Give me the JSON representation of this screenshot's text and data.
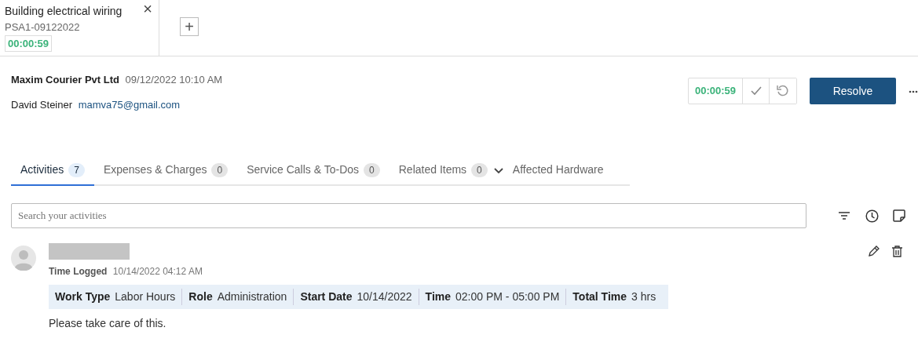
{
  "ticket_tab": {
    "title": "Building electrical wiring",
    "number": "PSA1-09122022",
    "timer": "00:00:59",
    "close": "×"
  },
  "add_tab": {
    "label": "+"
  },
  "header": {
    "company": "Maxim Courier Pvt Ltd",
    "date": "09/12/2022 10:10 AM",
    "contact": "David Steiner",
    "email": "mamva75@gmail.com"
  },
  "timer": {
    "value": "00:00:59"
  },
  "resolve_button": "Resolve",
  "tabs": [
    {
      "label": "Activities",
      "count": "7",
      "selected": true
    },
    {
      "label": "Expenses & Charges",
      "count": "0",
      "selected": false
    },
    {
      "label": "Service Calls & To-Dos",
      "count": "0",
      "selected": false
    },
    {
      "label": "Related Items",
      "count": "0",
      "selected": false
    },
    {
      "label": "Affected Hardware",
      "selected": false
    }
  ],
  "search": {
    "placeholder": "Search your activities"
  },
  "activity": {
    "type": "Time Logged",
    "time": "10/14/2022 04:12 AM",
    "details": [
      {
        "label": "Work Type",
        "value": "Labor Hours"
      },
      {
        "label": "Role",
        "value": "Administration"
      },
      {
        "label": "Start Date",
        "value": "10/14/2022"
      },
      {
        "label": "Time",
        "value": "02:00 PM - 05:00 PM"
      },
      {
        "label": "Total Time",
        "value": "3 hrs"
      }
    ],
    "note": "Please take care of this."
  }
}
